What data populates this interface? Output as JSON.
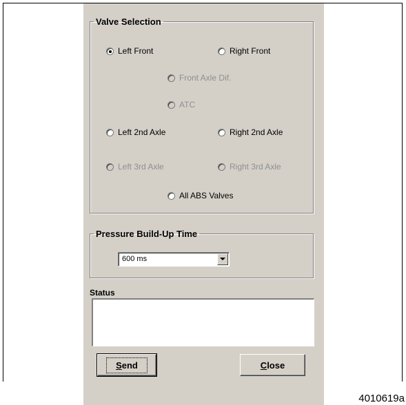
{
  "valve_selection": {
    "title": "Valve Selection",
    "options": [
      {
        "label": "Left Front",
        "checked": true,
        "enabled": true
      },
      {
        "label": "Right Front",
        "checked": false,
        "enabled": true
      },
      {
        "label": "Front Axle Dif.",
        "checked": false,
        "enabled": false
      },
      {
        "label": "ATC",
        "checked": false,
        "enabled": false
      },
      {
        "label": "Left 2nd Axle",
        "checked": false,
        "enabled": true
      },
      {
        "label": "Right 2nd Axle",
        "checked": false,
        "enabled": true
      },
      {
        "label": "Left 3rd Axle",
        "checked": false,
        "enabled": false
      },
      {
        "label": "Right 3rd Axle",
        "checked": false,
        "enabled": false
      },
      {
        "label": "All ABS Valves",
        "checked": false,
        "enabled": true
      }
    ]
  },
  "pressure": {
    "title": "Pressure Build-Up Time",
    "selected": "600 ms"
  },
  "status": {
    "label": "Status",
    "text": ""
  },
  "buttons": {
    "send": "Send",
    "close": "Close"
  },
  "figure_id": "4010619a",
  "colors": {
    "dialog_background": "#d4d0c8",
    "disabled_text": "#8f8f8f"
  }
}
